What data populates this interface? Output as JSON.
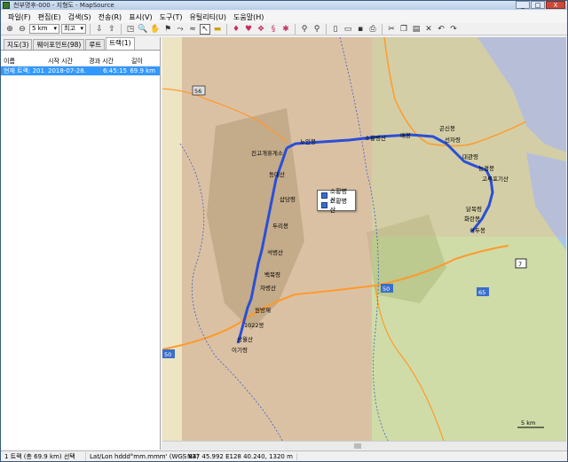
{
  "window": {
    "title": "천부명후-000 - 지형도 - MapSource"
  },
  "window_controls": [
    "_",
    "□",
    "X"
  ],
  "menu": [
    "파일(F)",
    "편집(E)",
    "검색(S)",
    "전송(R)",
    "표시(V)",
    "도구(T)",
    "유틸리티(U)",
    "도움말(H)"
  ],
  "toolbar": {
    "zoom_value": "5 km",
    "detail_value": "최고"
  },
  "tabs": [
    "지도(3)",
    "웨이포인트(98)",
    "루트",
    "트랙(1)"
  ],
  "track_list": {
    "columns": [
      "이름",
      "시작 시간",
      "경과 시간",
      "길이"
    ],
    "rows": [
      {
        "name": "현재 트랙: 201...",
        "start": "2018-07-28...",
        "elapsed": "6:45:15",
        "length": "69.9 km"
      }
    ]
  },
  "popup": {
    "items": [
      "소황병산",
      "소황병산"
    ]
  },
  "map_labels": {
    "waypoints": [
      "진고개휴게소",
      "동대산",
      "노인봉",
      "소황병산",
      "매봉",
      "곤신봉",
      "선자령",
      "대관령",
      "능경봉",
      "고루포기산",
      "닭목령",
      "화란봉",
      "석두봉",
      "삽당령",
      "두리봉",
      "석병산",
      "백복령",
      "자병산",
      "원방재",
      "1022봉",
      "상월산",
      "이기령"
    ],
    "road_badges": [
      "56",
      "7",
      "50",
      "50",
      "65"
    ],
    "scale": "5 km"
  },
  "status": {
    "selection": "1 트랙 (총 69.9 km) 선택",
    "format": "Lat/Lon hddd°mm.mmm' (WGS 84)",
    "coords": "N37 45.992 E128 40.240, 1320 m"
  },
  "colors": {
    "track": "#2a4fd6",
    "highlight_region": "#e9a0a0",
    "forest_dark": "#9aa86a",
    "road": "#ff9a2b",
    "sea": "#a9c8e8",
    "selection": "#3399ff"
  }
}
